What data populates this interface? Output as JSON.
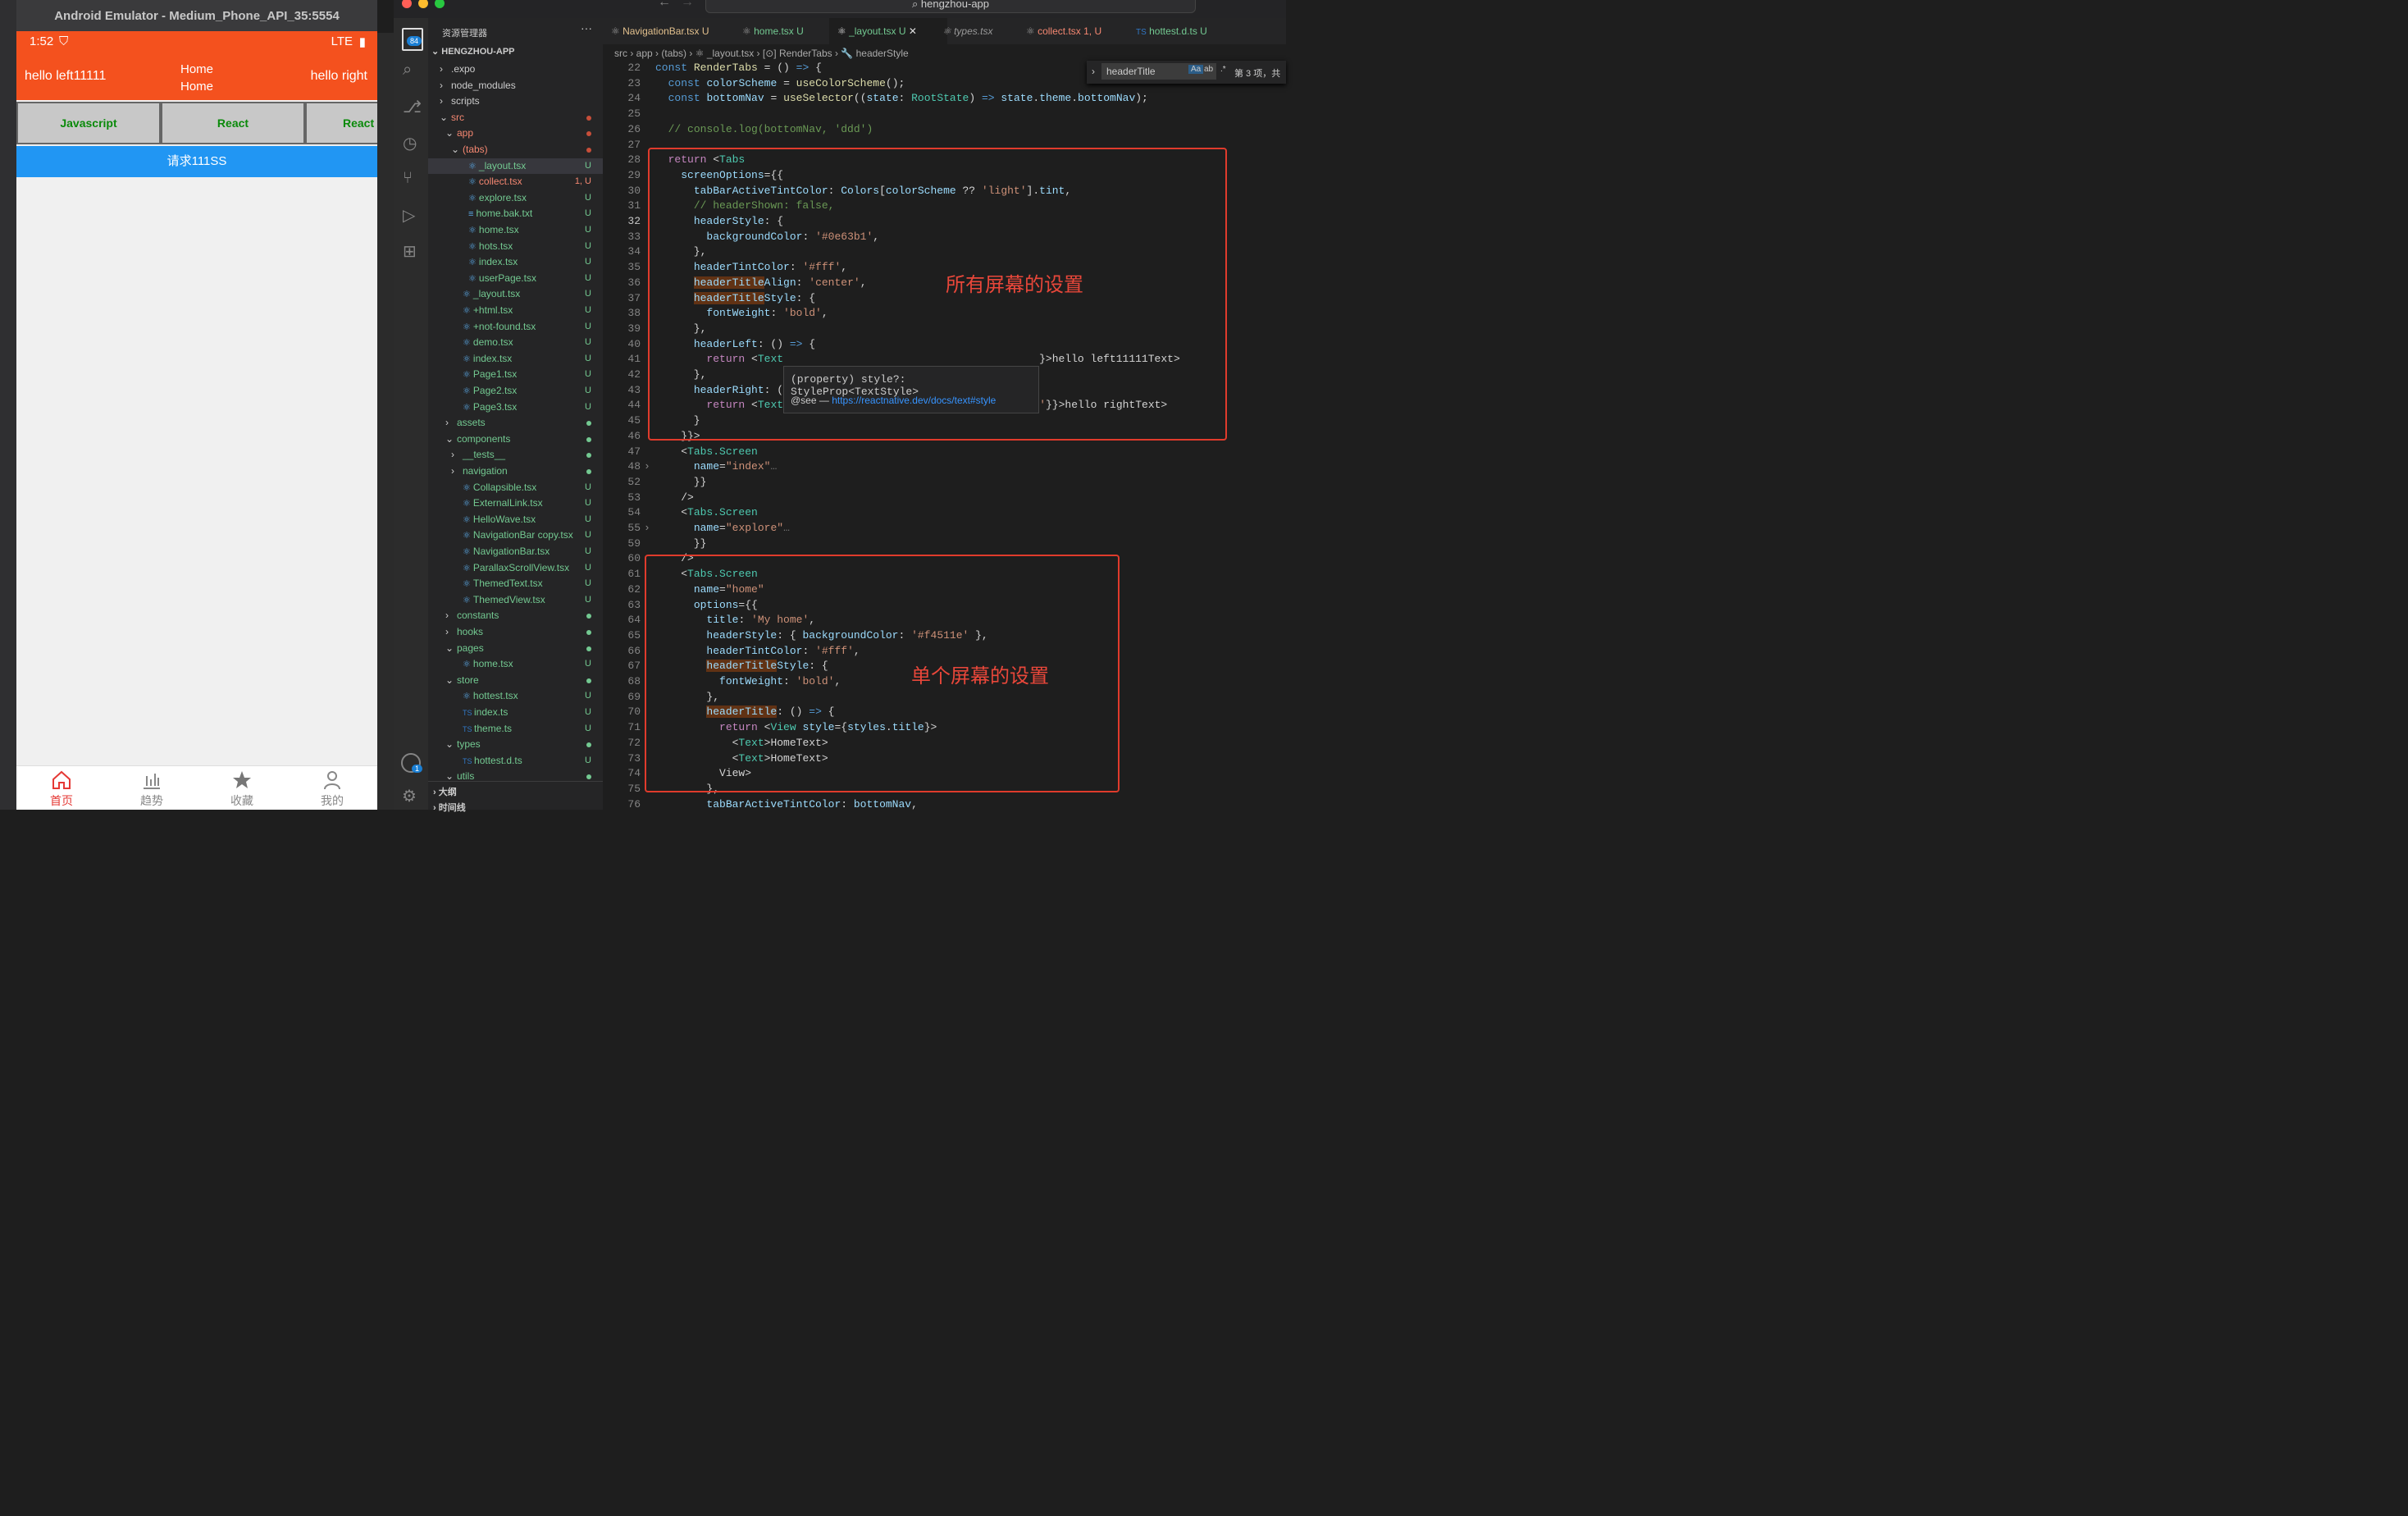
{
  "emulator": {
    "window_title": "Android Emulator - Medium_Phone_API_35:5554",
    "status_time": "1:52",
    "status_network": "LTE",
    "header": {
      "left": "hello left11111",
      "title_line1": "Home",
      "title_line2": "Home",
      "right": "hello right",
      "color": "#f4511e"
    },
    "tabs": [
      "Javascript",
      "React",
      "React"
    ],
    "request_button": "请求111SS",
    "bottom_nav": [
      {
        "label": "首页",
        "icon": "home-icon",
        "active": true
      },
      {
        "label": "趋势",
        "icon": "chart-icon",
        "active": false
      },
      {
        "label": "收藏",
        "icon": "star-icon",
        "active": false
      },
      {
        "label": "我的",
        "icon": "user-icon",
        "active": false
      }
    ]
  },
  "vscode": {
    "search_text": "hengzhou-app",
    "explorer_title": "资源管理器",
    "project": "HENGZHOU-APP",
    "activity_badges": {
      "explorer": "84",
      "account": "1"
    },
    "tabs": [
      {
        "label": "NavigationBar.tsx",
        "badge": "U"
      },
      {
        "label": "home.tsx",
        "badge": "U"
      },
      {
        "label": "_layout.tsx",
        "badge": "U"
      },
      {
        "label": "types.tsx",
        "badge": ""
      },
      {
        "label": "collect.tsx",
        "badge": "1, U"
      },
      {
        "label": "hottest.d.ts",
        "badge": "U"
      }
    ],
    "breadcrumb": [
      "src",
      "app",
      "(tabs)",
      "_layout.tsx",
      "RenderTabs",
      "headerStyle"
    ],
    "find": {
      "query": "headerTitle",
      "result": "第 3 项，共"
    },
    "tree": [
      {
        "label": ".expo",
        "indent": 0,
        "arrow": "›",
        "status": ""
      },
      {
        "label": "node_modules",
        "indent": 0,
        "arrow": "›",
        "status": ""
      },
      {
        "label": "scripts",
        "indent": 0,
        "arrow": "›",
        "status": ""
      },
      {
        "label": "src",
        "indent": 0,
        "arrow": "⌄",
        "status": "dot-red",
        "color": "#f48771"
      },
      {
        "label": "app",
        "indent": 1,
        "arrow": "⌄",
        "status": "dot-red",
        "color": "#f48771"
      },
      {
        "label": "(tabs)",
        "indent": 2,
        "arrow": "⌄",
        "status": "dot-red",
        "color": "#f48771"
      },
      {
        "label": "_layout.tsx",
        "indent": 3,
        "arrow": "",
        "status": "U",
        "selected": true
      },
      {
        "label": "collect.tsx",
        "indent": 3,
        "arrow": "",
        "status": "1, U",
        "color": "#f48771"
      },
      {
        "label": "explore.tsx",
        "indent": 3,
        "arrow": "",
        "status": "U"
      },
      {
        "label": "home.bak.txt",
        "indent": 3,
        "arrow": "",
        "status": "U"
      },
      {
        "label": "home.tsx",
        "indent": 3,
        "arrow": "",
        "status": "U"
      },
      {
        "label": "hots.tsx",
        "indent": 3,
        "arrow": "",
        "status": "U"
      },
      {
        "label": "index.tsx",
        "indent": 3,
        "arrow": "",
        "status": "U"
      },
      {
        "label": "userPage.tsx",
        "indent": 3,
        "arrow": "",
        "status": "U"
      },
      {
        "label": "_layout.tsx",
        "indent": 2,
        "arrow": "",
        "status": "U"
      },
      {
        "label": "+html.tsx",
        "indent": 2,
        "arrow": "",
        "status": "U"
      },
      {
        "label": "+not-found.tsx",
        "indent": 2,
        "arrow": "",
        "status": "U"
      },
      {
        "label": "demo.tsx",
        "indent": 2,
        "arrow": "",
        "status": "U"
      },
      {
        "label": "index.tsx",
        "indent": 2,
        "arrow": "",
        "status": "U"
      },
      {
        "label": "Page1.tsx",
        "indent": 2,
        "arrow": "",
        "status": "U"
      },
      {
        "label": "Page2.tsx",
        "indent": 2,
        "arrow": "",
        "status": "U"
      },
      {
        "label": "Page3.tsx",
        "indent": 2,
        "arrow": "",
        "status": "U"
      },
      {
        "label": "assets",
        "indent": 1,
        "arrow": "›",
        "status": "dot"
      },
      {
        "label": "components",
        "indent": 1,
        "arrow": "⌄",
        "status": "dot"
      },
      {
        "label": "__tests__",
        "indent": 2,
        "arrow": "›",
        "status": "dot"
      },
      {
        "label": "navigation",
        "indent": 2,
        "arrow": "›",
        "status": "dot"
      },
      {
        "label": "Collapsible.tsx",
        "indent": 2,
        "arrow": "",
        "status": "U"
      },
      {
        "label": "ExternalLink.tsx",
        "indent": 2,
        "arrow": "",
        "status": "U"
      },
      {
        "label": "HelloWave.tsx",
        "indent": 2,
        "arrow": "",
        "status": "U"
      },
      {
        "label": "NavigationBar copy.tsx",
        "indent": 2,
        "arrow": "",
        "status": "U"
      },
      {
        "label": "NavigationBar.tsx",
        "indent": 2,
        "arrow": "",
        "status": "U"
      },
      {
        "label": "ParallaxScrollView.tsx",
        "indent": 2,
        "arrow": "",
        "status": "U"
      },
      {
        "label": "ThemedText.tsx",
        "indent": 2,
        "arrow": "",
        "status": "U"
      },
      {
        "label": "ThemedView.tsx",
        "indent": 2,
        "arrow": "",
        "status": "U"
      },
      {
        "label": "constants",
        "indent": 1,
        "arrow": "›",
        "status": "dot"
      },
      {
        "label": "hooks",
        "indent": 1,
        "arrow": "›",
        "status": "dot"
      },
      {
        "label": "pages",
        "indent": 1,
        "arrow": "⌄",
        "status": "dot"
      },
      {
        "label": "home.tsx",
        "indent": 2,
        "arrow": "",
        "status": "U"
      },
      {
        "label": "store",
        "indent": 1,
        "arrow": "⌄",
        "status": "dot"
      },
      {
        "label": "hottest.tsx",
        "indent": 2,
        "arrow": "",
        "status": "U"
      },
      {
        "label": "index.ts",
        "indent": 2,
        "arrow": "",
        "status": "U",
        "ts": true
      },
      {
        "label": "theme.ts",
        "indent": 2,
        "arrow": "",
        "status": "U",
        "ts": true
      },
      {
        "label": "types",
        "indent": 1,
        "arrow": "⌄",
        "status": "dot"
      },
      {
        "label": "hottest.d.ts",
        "indent": 2,
        "arrow": "",
        "status": "U",
        "ts": true
      },
      {
        "label": "utils",
        "indent": 1,
        "arrow": "⌄",
        "status": "dot"
      }
    ],
    "outline_label": "大纲",
    "timeline_label": "时间线",
    "code_lines": [
      {
        "n": "22",
        "html": "<span class='kb'>const</span> <span class='fn'>RenderTabs</span> = () <span class='kb'>=></span> {"
      },
      {
        "n": "23",
        "html": "  <span class='kb'>const</span> <span class='vr'>colorScheme</span> = <span class='fn'>useColorScheme</span>();"
      },
      {
        "n": "24",
        "html": "  <span class='kb'>const</span> <span class='vr'>bottomNav</span> = <span class='fn'>useSelector</span>((<span class='vr'>state</span>: <span class='ty'>RootState</span>) <span class='kb'>=></span> <span class='vr'>state</span>.<span class='vr'>theme</span>.<span class='vr'>bottomNav</span>);"
      },
      {
        "n": "25",
        "html": ""
      },
      {
        "n": "26",
        "html": "  <span class='cm'>// console.log(bottomNav, 'ddd')</span>"
      },
      {
        "n": "27",
        "html": ""
      },
      {
        "n": "28",
        "html": "  <span class='kw'>return</span> <<span class='tg'>Tabs</span>"
      },
      {
        "n": "29",
        "html": "    <span class='vr'>screenOptions</span>={{"
      },
      {
        "n": "30",
        "html": "      <span class='vr'>tabBarActiveTintColor</span>: <span class='vr'>Colors</span>[<span class='vr'>colorScheme</span> ?? <span class='st'>'light'</span>].<span class='vr'>tint</span>,"
      },
      {
        "n": "31",
        "html": "      <span class='cm'>// headerShown: false,</span>"
      },
      {
        "n": "32",
        "html": "      <span class='vr'>headerStyle</span>: {",
        "cur": true
      },
      {
        "n": "33",
        "html": "        <span class='vr'>backgroundColor</span>: <span class='st'>'#0e63b1'</span>,"
      },
      {
        "n": "34",
        "html": "      },"
      },
      {
        "n": "35",
        "html": "      <span class='vr'>headerTintColor</span>: <span class='st'>'#fff'</span>,"
      },
      {
        "n": "36",
        "html": "      <span class='vr hl'>headerTitle</span><span class='vr'>Align</span>: <span class='st'>'center'</span>,"
      },
      {
        "n": "37",
        "html": "      <span class='vr hl'>headerTitle</span><span class='vr'>Style</span>: {"
      },
      {
        "n": "38",
        "html": "        <span class='vr'>fontWeight</span>: <span class='st'>'bold'</span>,"
      },
      {
        "n": "39",
        "html": "      },"
      },
      {
        "n": "40",
        "html": "      <span class='vr'>headerLeft</span>: () <span class='kb'>=></span> {"
      },
      {
        "n": "41",
        "html": "        <span class='kw'>return</span> <<span class='tg'>Text</span>                                        }>hello left11111</<span class='tg'>Text</span>>"
      },
      {
        "n": "42",
        "html": "      },"
      },
      {
        "n": "43",
        "html": "      <span class='vr'>headerRight</span>: ()"
      },
      {
        "n": "44",
        "html": "        <span class='kw'>return</span> <<span class='tg'>Text</span> <span class='vr' style='text-decoration:underline'>style</span>={{ <span class='vr'>paddingRight</span>: <span class='st'>10</span>, <span class='vr'>color</span>: <span class='st'>'#fff'</span>}}>hello right</<span class='tg'>Text</span>>"
      },
      {
        "n": "45",
        "html": "      }"
      },
      {
        "n": "46",
        "html": "    }}>"
      },
      {
        "n": "47",
        "html": "    <<span class='tg'>Tabs.Screen</span>"
      },
      {
        "n": "48",
        "html": "      <span class='vr'>name</span>=<span class='st'>\"index\"</span><span style='color:#777'>…</span>",
        "fold": true
      },
      {
        "n": "52",
        "html": "      }}"
      },
      {
        "n": "53",
        "html": "    />"
      },
      {
        "n": "54",
        "html": "    <<span class='tg'>Tabs.Screen</span>"
      },
      {
        "n": "55",
        "html": "      <span class='vr'>name</span>=<span class='st'>\"explore\"</span><span style='color:#777'>…</span>",
        "fold": true
      },
      {
        "n": "59",
        "html": "      }}"
      },
      {
        "n": "60",
        "html": "    />"
      },
      {
        "n": "61",
        "html": "    <<span class='tg'>Tabs.Screen</span>"
      },
      {
        "n": "62",
        "html": "      <span class='vr'>name</span>=<span class='st'>\"home\"</span>"
      },
      {
        "n": "63",
        "html": "      <span class='vr'>options</span>={{"
      },
      {
        "n": "64",
        "html": "        <span class='vr'>title</span>: <span class='st'>'My home'</span>,"
      },
      {
        "n": "65",
        "html": "        <span class='vr'>headerStyle</span>: { <span class='vr'>backgroundColor</span>: <span class='st'>'#f4511e'</span> },"
      },
      {
        "n": "66",
        "html": "        <span class='vr'>headerTintColor</span>: <span class='st'>'#fff'</span>,"
      },
      {
        "n": "67",
        "html": "        <span class='vr hl'>headerTitle</span><span class='vr'>Style</span>: {"
      },
      {
        "n": "68",
        "html": "          <span class='vr'>fontWeight</span>: <span class='st'>'bold'</span>,"
      },
      {
        "n": "69",
        "html": "        },"
      },
      {
        "n": "70",
        "html": "        <span class='vr hl'>headerTitle</span>: () <span class='kb'>=></span> {"
      },
      {
        "n": "71",
        "html": "          <span class='kw'>return</span> <<span class='tg'>View</span> <span class='vr'>style</span>={<span class='vr'>styles</span>.<span class='vr'>title</span>}>"
      },
      {
        "n": "72",
        "html": "            <<span class='tg'>Text</span>>Home</<span class='tg'>Text</span>>"
      },
      {
        "n": "73",
        "html": "            <<span class='tg'>Text</span>>Home</<span class='tg'>Text</span>>"
      },
      {
        "n": "74",
        "html": "          </<span class='tg'>View</span>>"
      },
      {
        "n": "75",
        "html": "        },"
      },
      {
        "n": "76",
        "html": "        <span class='vr'>tabBarActiveTintColor</span>: <span class='vr'>bottomNav</span>,"
      }
    ],
    "tooltip": {
      "signature": "(property) style?: StyleProp<TextStyle>",
      "see_label": "@see —",
      "link": "https://reactnative.dev/docs/text#style"
    },
    "annotations": {
      "all_screens": "所有屏幕的设置",
      "single_screen": "单个屏幕的设置",
      "color": "#e03b2c"
    }
  }
}
